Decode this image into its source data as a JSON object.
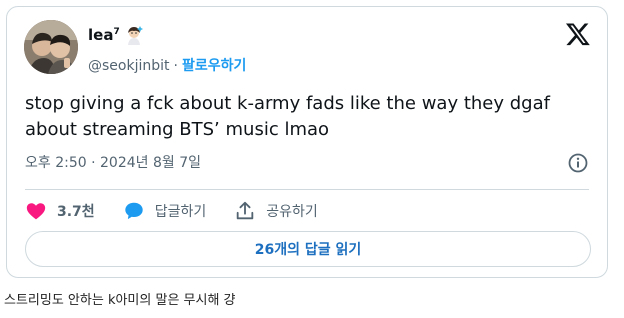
{
  "tweet": {
    "user": {
      "display_name": "lea",
      "name_superscript": "7",
      "handle": "@seokjinbit",
      "separator": "·",
      "follow_label": "팔로우하기"
    },
    "text": "stop giving a fck about k-army fads like the way they dgaf about streaming BTS’ music lmao",
    "timestamp": "오후 2:50 · 2024년 8월 7일",
    "actions": {
      "likes": {
        "count": "3.7천"
      },
      "reply": {
        "label": "답글하기"
      },
      "share": {
        "label": "공유하기"
      }
    },
    "read_replies_label": "26개의 답글 읽기"
  },
  "caption": "스트리밍도 안하는 k아미의 말은 무시해 걍",
  "colors": {
    "like": "#f91880",
    "reply": "#1d9bf0",
    "link": "#1d9bf0",
    "border": "#cfd9de",
    "muted": "#536471"
  },
  "icons": {
    "brand": "x-logo-icon",
    "like": "heart-icon",
    "reply": "speech-bubble-icon",
    "share": "share-upload-icon",
    "info": "info-icon",
    "badge": "emoji-badge-icon"
  }
}
